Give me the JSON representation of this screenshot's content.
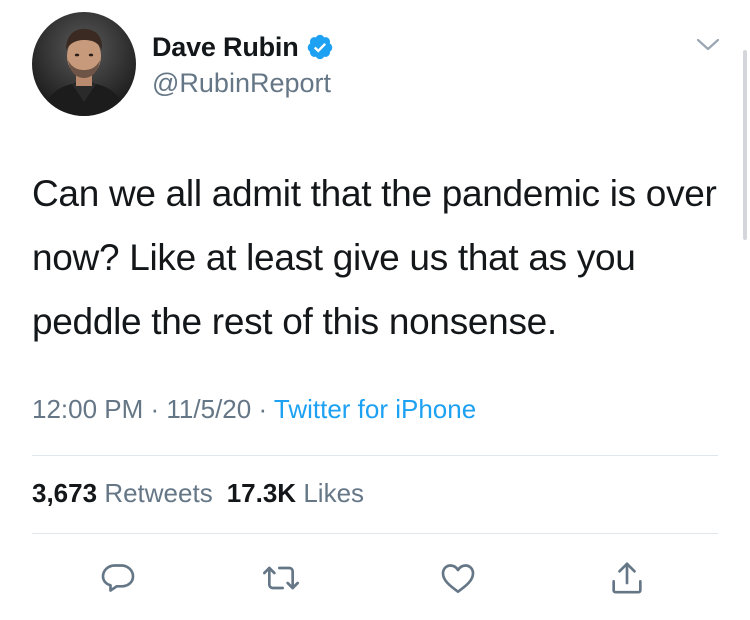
{
  "user": {
    "display_name": "Dave Rubin",
    "handle": "@RubinReport",
    "verified": true,
    "avatar": "profile-photo"
  },
  "tweet": {
    "text": "Can we all admit that the pandemic is over now? Like at least give us that as you peddle the rest of this nonsense.",
    "time": "12:00 PM",
    "date": "11/5/20",
    "source": "Twitter for iPhone",
    "separator": " · "
  },
  "stats": {
    "retweets_count": "3,673",
    "retweets_label": "Retweets",
    "likes_count": "17.3K",
    "likes_label": "Likes"
  },
  "actions": [
    {
      "name": "reply",
      "icon": "reply-icon"
    },
    {
      "name": "retweet",
      "icon": "retweet-icon"
    },
    {
      "name": "like",
      "icon": "heart-icon"
    },
    {
      "name": "share",
      "icon": "share-icon"
    }
  ],
  "colors": {
    "text": "#14171a",
    "secondary": "#657786",
    "link": "#1da1f2",
    "verified": "#1da1f2",
    "divider": "#e1e8ed"
  }
}
